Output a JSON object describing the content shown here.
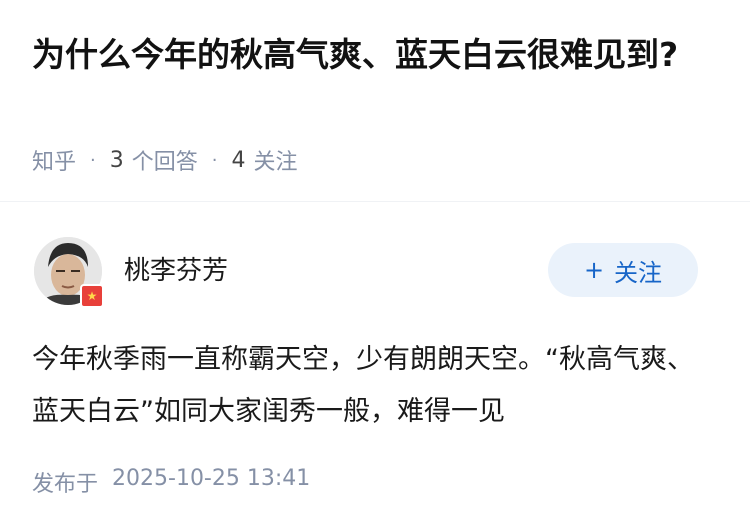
{
  "question": {
    "title": "为什么今年的秋高气爽、蓝天白云很难见到?",
    "source": "知乎",
    "answers_count": "3",
    "answers_label": "个回答",
    "follows_count": "4",
    "follows_label": "关注"
  },
  "answer": {
    "author": "桃李芬芳",
    "follow_button_icon": "plus-icon",
    "follow_button_plus": "+",
    "follow_button_label": "关注",
    "content": "今年秋季雨一直称霸天空，少有朗朗天空。“秋高气爽、蓝天白云”如同大家闺秀一般，难得一见",
    "published_label": "发布于",
    "published_time": "2025-10-25 13:41"
  },
  "colors": {
    "accent": "#1765c8",
    "button_bg": "#eaf2fb",
    "muted": "#8590a6"
  }
}
